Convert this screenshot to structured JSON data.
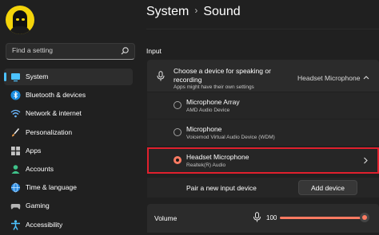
{
  "header": {
    "parent": "System",
    "separator": "›",
    "current": "Sound"
  },
  "search": {
    "placeholder": "Find a setting"
  },
  "sidebar": {
    "items": [
      {
        "label": "System",
        "icon": "monitor-icon",
        "active": true
      },
      {
        "label": "Bluetooth & devices",
        "icon": "bluetooth-icon"
      },
      {
        "label": "Network & internet",
        "icon": "wifi-icon"
      },
      {
        "label": "Personalization",
        "icon": "brush-icon"
      },
      {
        "label": "Apps",
        "icon": "apps-icon"
      },
      {
        "label": "Accounts",
        "icon": "person-icon"
      },
      {
        "label": "Time & language",
        "icon": "globe-icon"
      },
      {
        "label": "Gaming",
        "icon": "gamepad-icon"
      },
      {
        "label": "Accessibility",
        "icon": "accessibility-icon"
      }
    ]
  },
  "input": {
    "section_title": "Input",
    "choose_line1": "Choose a device for speaking or",
    "choose_line2": "recording",
    "choose_sub": "Apps might have their own settings",
    "selected_device": "Headset Microphone",
    "devices": [
      {
        "name": "Microphone Array",
        "desc": "AMD Audio Device",
        "selected": false
      },
      {
        "name": "Microphone",
        "desc": "Voicemod Virtual Audio Device (WDM)",
        "selected": false
      },
      {
        "name": "Headset Microphone",
        "desc": "Realtek(R) Audio",
        "selected": true
      }
    ],
    "pair_label": "Pair a new input device",
    "add_button": "Add device"
  },
  "volume": {
    "label": "Volume",
    "value": "100",
    "level_percent": 100
  },
  "colors": {
    "accent": "#4cc2ff",
    "slider": "#ff7b62",
    "highlight_border": "#e0202d"
  }
}
